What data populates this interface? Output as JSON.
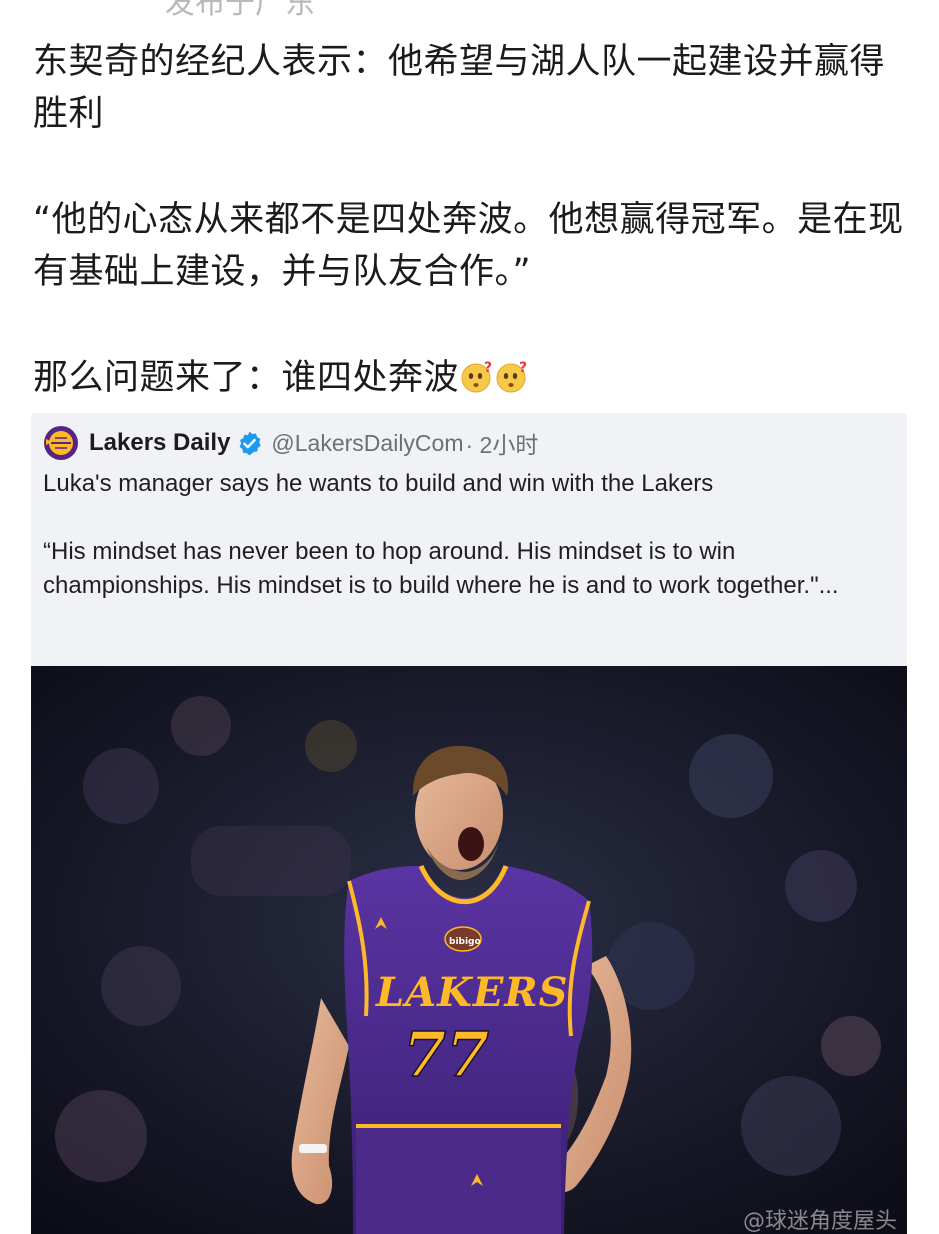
{
  "post": {
    "cutoff_header": "发布于广东",
    "title_line": "东契奇的经纪人表示：他希望与湖人队一起建设并赢得胜利",
    "quote_line": "“他的心态从来都不是四处奔波。他想赢得冠军。是在现有基础上建设，并与队友合作。”",
    "question_line": "那么问题来了：谁四处奔波",
    "emoji_names": [
      "thinking-question-face",
      "thinking-question-face"
    ]
  },
  "embedded_tweet": {
    "account_name": "Lakers Daily",
    "handle": "@LakersDailyCom",
    "time": "· 2小时",
    "text_line": "Luka's manager says he wants to build and win with the Lakers",
    "quote_text": "“His mindset has never been to hop around. His mindset is to win championships. His mindset is to build where he is and to work together.\"...",
    "verified": true,
    "accent_color": "#1d9bf0",
    "avatar_colors": [
      "#552583",
      "#fdb927"
    ]
  },
  "photo": {
    "jersey_team": "LAKERS",
    "jersey_number": "77",
    "jersey_patch": "bibigo",
    "jersey_color": "#4b2a8a",
    "trim_color": "#fdb927",
    "watermark": "@球迷角度屋头"
  }
}
